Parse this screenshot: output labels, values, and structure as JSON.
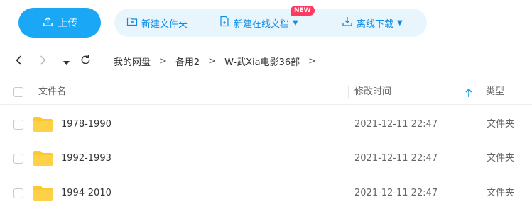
{
  "toolbar": {
    "upload_label": "上传",
    "new_folder_label": "新建文件夹",
    "new_online_doc_label": "新建在线文档",
    "new_badge": "NEW",
    "offline_download_label": "离线下载"
  },
  "navigation": {
    "breadcrumb": [
      "我的网盘",
      "备用2",
      "W-武Xia电影36部"
    ],
    "separator": ">"
  },
  "table": {
    "columns": {
      "name": "文件名",
      "modified": "修改时间",
      "type": "类型"
    },
    "sort": {
      "column": "modified",
      "direction": "asc"
    },
    "rows": [
      {
        "name": "1978-1990",
        "modified": "2021-12-11 22:47",
        "type": "文件夹"
      },
      {
        "name": "1992-1993",
        "modified": "2021-12-11 22:47",
        "type": "文件夹"
      },
      {
        "name": "1994-2010",
        "modified": "2021-12-11 22:47",
        "type": "文件夹"
      }
    ]
  },
  "colors": {
    "accent": "#1aa7f5",
    "action_text": "#0a8be6",
    "action_bg": "#e9f5fd",
    "badge": "#fe3a62",
    "folder": "#fdc933"
  }
}
